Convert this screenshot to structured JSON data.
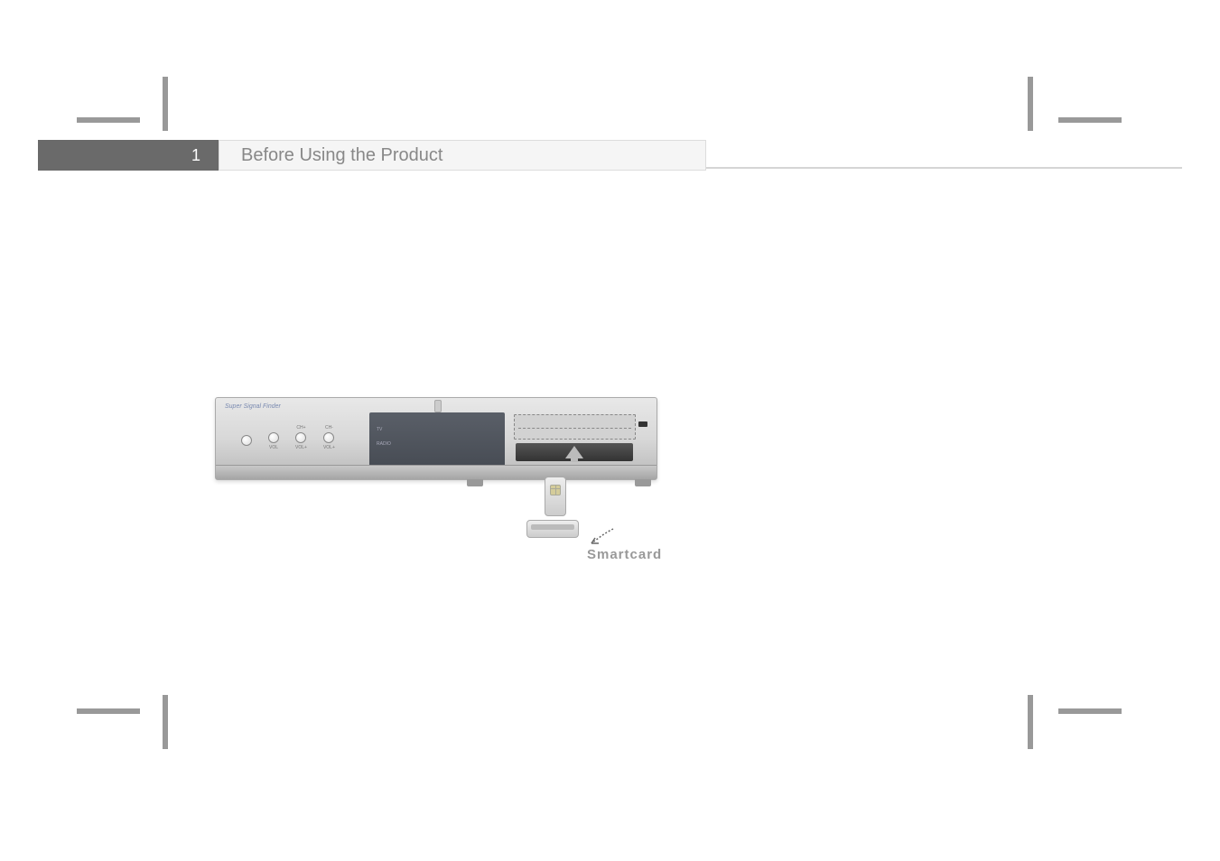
{
  "header": {
    "chapter_number": "1",
    "chapter_title": "Before Using the Product"
  },
  "device": {
    "brand_label": "Super Signal Finder",
    "buttons": [
      {
        "top": "",
        "bottom": ""
      },
      {
        "top": "",
        "bottom": "VOL"
      },
      {
        "top": "CH+",
        "bottom": "VOL+"
      },
      {
        "top": "CH-",
        "bottom": "VOL+"
      }
    ],
    "panel_label_1": "TV",
    "panel_label_2": "RADIO"
  },
  "smartcard": {
    "label": "Smartcard"
  }
}
